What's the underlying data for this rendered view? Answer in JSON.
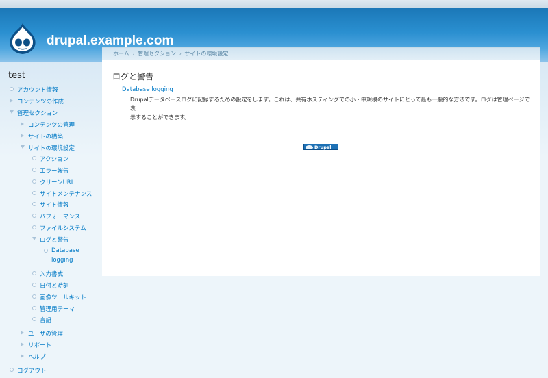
{
  "header": {
    "site_name": "drupal.example.com"
  },
  "sidebar": {
    "title": "test",
    "items": [
      {
        "label": "アカウント情報"
      },
      {
        "label": "コンテンツの作成"
      },
      {
        "label": "管理セクション"
      },
      {
        "label": "コンテンツの管理"
      },
      {
        "label": "サイトの構築"
      },
      {
        "label": "サイトの環境設定"
      },
      {
        "label": "アクション"
      },
      {
        "label": "エラー報告"
      },
      {
        "label": "クリーンURL"
      },
      {
        "label": "サイトメンテナンス"
      },
      {
        "label": "サイト情報"
      },
      {
        "label": "パフォーマンス"
      },
      {
        "label": "ファイルシステム"
      },
      {
        "label": "ログと警告"
      },
      {
        "label": "Database"
      },
      {
        "label": "logging"
      },
      {
        "label": "入力書式"
      },
      {
        "label": "日付と時刻"
      },
      {
        "label": "画像ツールキット"
      },
      {
        "label": "管理用テーマ"
      },
      {
        "label": "言語"
      },
      {
        "label": "ユーザの管理"
      },
      {
        "label": "リポート"
      },
      {
        "label": "ヘルプ"
      },
      {
        "label": "ログアウト"
      }
    ]
  },
  "breadcrumb": {
    "items": [
      "ホーム",
      "管理セクション",
      "サイトの環境設定"
    ],
    "separator": "›"
  },
  "main": {
    "page_title": "ログと警告",
    "entry_title": "Database logging",
    "entry_desc_line1": "Drupalデータベースログに記録するための設定をします。これは、共有ホスティングでの小・中規模のサイトにとって最も一般的な方法です。ログは管理ページで表",
    "entry_desc_line2": "示することができます。"
  },
  "footer": {
    "powered_label": "Drupal"
  },
  "colors": {
    "link": "#027ac6",
    "header_top": "#1b78b8",
    "header_bottom": "#8cc3ea",
    "page_bg": "#edf5fa"
  }
}
